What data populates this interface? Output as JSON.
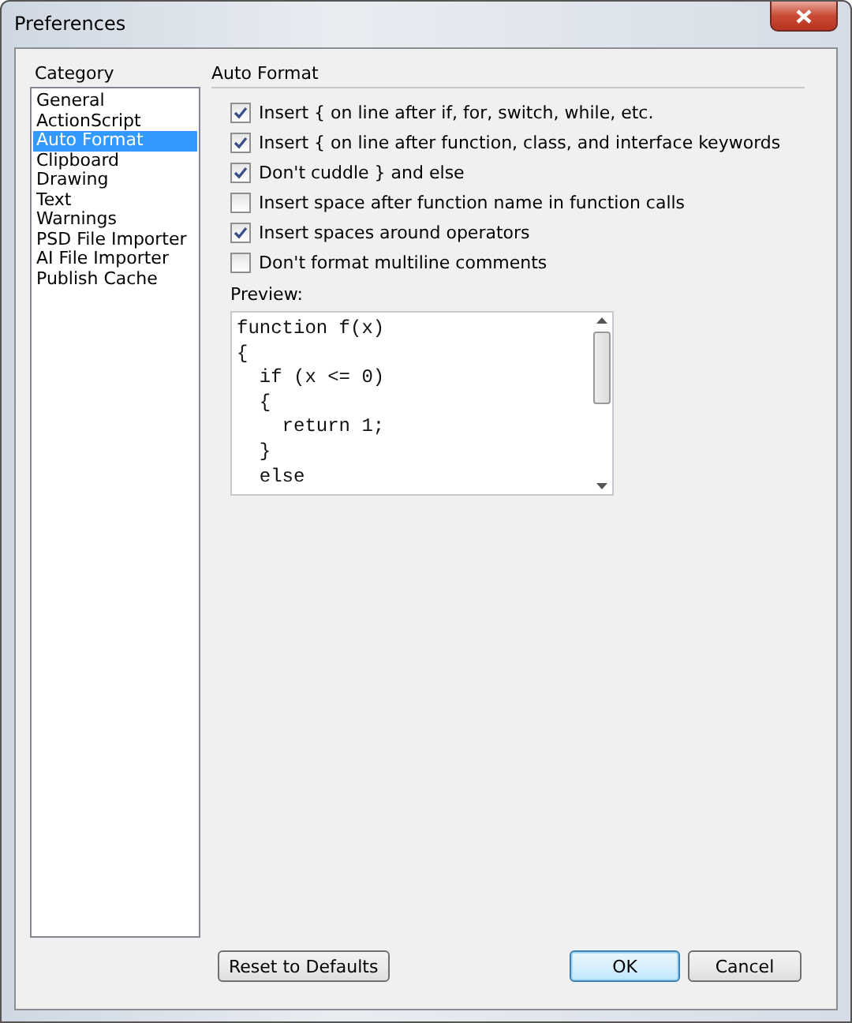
{
  "window": {
    "title": "Preferences"
  },
  "category": {
    "label": "Category",
    "items": [
      {
        "label": "General",
        "selected": false
      },
      {
        "label": "ActionScript",
        "selected": false
      },
      {
        "label": "Auto Format",
        "selected": true
      },
      {
        "label": "Clipboard",
        "selected": false
      },
      {
        "label": "Drawing",
        "selected": false
      },
      {
        "label": "Text",
        "selected": false
      },
      {
        "label": "Warnings",
        "selected": false
      },
      {
        "label": "PSD File Importer",
        "selected": false
      },
      {
        "label": "AI File Importer",
        "selected": false
      },
      {
        "label": "Publish Cache",
        "selected": false
      }
    ]
  },
  "panel": {
    "title": "Auto Format",
    "options": [
      {
        "label": "Insert { on line after if, for, switch, while, etc.",
        "checked": true
      },
      {
        "label": "Insert { on line after function, class, and interface keywords",
        "checked": true
      },
      {
        "label": "Don't cuddle } and else",
        "checked": true
      },
      {
        "label": "Insert space after function name in function calls",
        "checked": false
      },
      {
        "label": "Insert spaces around operators",
        "checked": true
      },
      {
        "label": "Don't format multiline comments",
        "checked": false
      }
    ],
    "preview": {
      "label": "Preview:",
      "lines": [
        "function f(x)",
        "{",
        "  if (x <= 0)",
        "  {",
        "    return 1;",
        "  }",
        "  else"
      ]
    }
  },
  "buttons": [
    {
      "label": "Reset to Defaults",
      "default": false
    },
    {
      "label": "OK",
      "default": true
    },
    {
      "label": "Cancel",
      "default": false
    }
  ]
}
